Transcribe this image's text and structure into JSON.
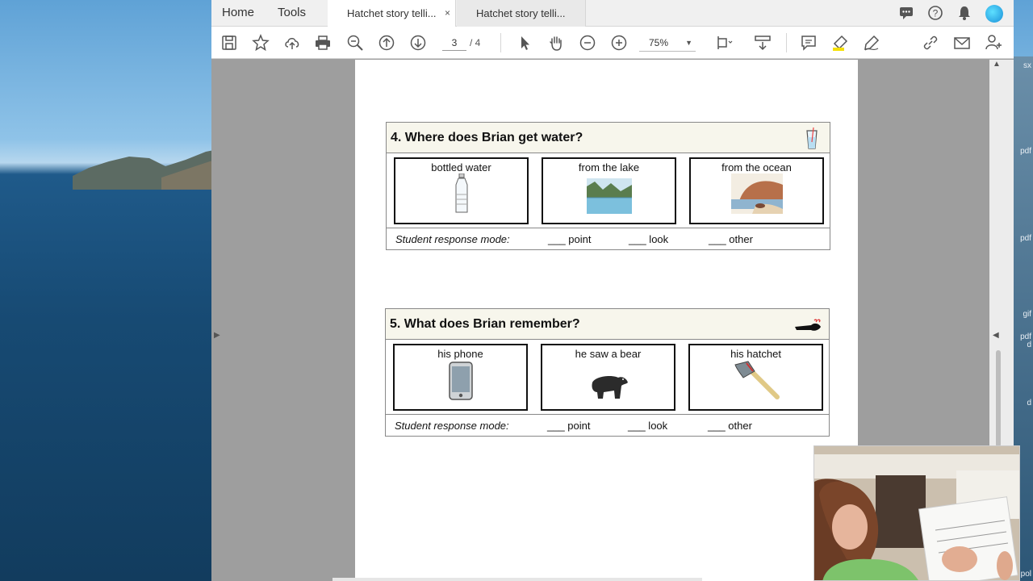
{
  "desktop": {
    "side_labels": [
      "sx",
      "pdf",
      "pdf",
      "gif",
      "pdf",
      "d",
      "d",
      "pol"
    ]
  },
  "app": {
    "nav": {
      "home": "Home",
      "tools": "Tools"
    },
    "tabs": [
      {
        "label": "Hatchet story telli...",
        "active": true,
        "close": "×"
      },
      {
        "label": "Hatchet story telli...",
        "active": false
      }
    ],
    "toolbar": {
      "page_current": "3",
      "page_total": "/ 4",
      "zoom": "75%"
    }
  },
  "document": {
    "questions": [
      {
        "title": "4. Where does Brian get water?",
        "header_icon": "glass-of-water-icon",
        "choices": [
          {
            "label": "bottled water",
            "icon": "water-bottle-icon"
          },
          {
            "label": "from the lake",
            "icon": "lake-picture-icon"
          },
          {
            "label": "from the ocean",
            "icon": "ocean-picture-icon"
          }
        ],
        "response": {
          "label": "Student response mode:",
          "options": [
            "___  point",
            "___  look",
            "___  other"
          ]
        }
      },
      {
        "title": "5. What does Brian remember?",
        "header_icon": "remember-finger-icon",
        "choices": [
          {
            "label": "his phone",
            "icon": "phone-icon"
          },
          {
            "label": "he saw a bear",
            "icon": "bear-icon"
          },
          {
            "label": "his hatchet",
            "icon": "hatchet-icon"
          }
        ],
        "response": {
          "label": "Student response mode:",
          "options": [
            "___  point",
            "___  look",
            "___  other"
          ]
        }
      }
    ]
  },
  "colors": {
    "accent_highlight": "#f5e000",
    "header_fill": "#f7f6ec"
  }
}
